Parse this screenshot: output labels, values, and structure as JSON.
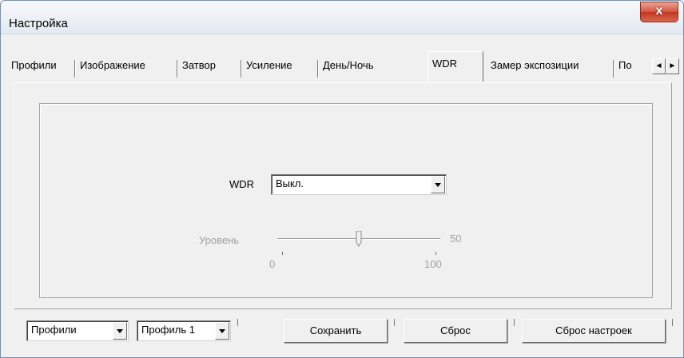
{
  "window": {
    "title": "Настройка",
    "close_glyph": "x"
  },
  "tabs": [
    {
      "label": "Профили",
      "active": false
    },
    {
      "label": "Изображение",
      "active": false
    },
    {
      "label": "Затвор",
      "active": false
    },
    {
      "label": "Усиление",
      "active": false
    },
    {
      "label": "День/Ночь",
      "active": false
    },
    {
      "label": "WDR",
      "active": true
    },
    {
      "label": "Замер экспозиции",
      "active": false
    },
    {
      "label": "По",
      "active": false
    }
  ],
  "tab_scroll": {
    "left_glyph": "◄",
    "right_glyph": "►"
  },
  "wdr": {
    "label": "WDR",
    "selected": "Выкл."
  },
  "level": {
    "label": "Уровень",
    "value": 50,
    "value_text": "50",
    "min": 0,
    "max": 100,
    "min_text": "0",
    "max_text": "100",
    "enabled": false
  },
  "bottom": {
    "profiles_select": "Профили",
    "profile_select": "Профиль 1",
    "save_label": "Сохранить",
    "reset_label": "Сброс",
    "reset_settings_label": "Сброс настроек"
  },
  "colors": {
    "close_red": "#c2361f",
    "disabled_text": "#a0a0a0",
    "face": "#f0f0f0"
  }
}
